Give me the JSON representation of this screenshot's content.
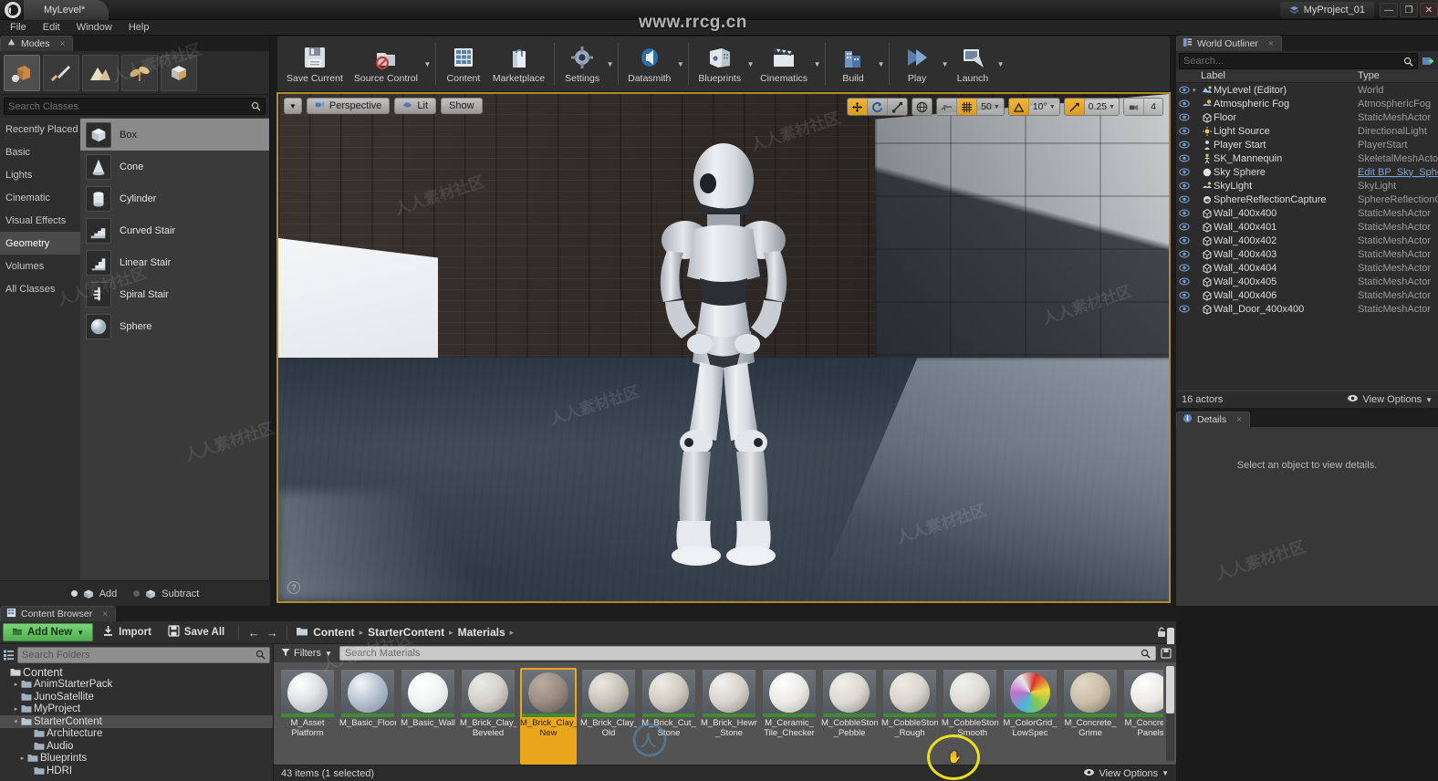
{
  "titlebar": {
    "level_tab": "MyLevel*",
    "project_name": "MyProject_01",
    "minimize": "—",
    "maximize": "❐",
    "close": "✕"
  },
  "menubar": {
    "items": [
      "File",
      "Edit",
      "Window",
      "Help"
    ]
  },
  "watermark": {
    "top_text": "www.rrcg.cn",
    "site": "人人素材社区"
  },
  "modes_panel": {
    "tab_label": "Modes",
    "tab_close": "×",
    "mode_buttons": [
      {
        "name": "place-mode",
        "active": true
      },
      {
        "name": "paint-mode",
        "active": false
      },
      {
        "name": "landscape-mode",
        "active": false
      },
      {
        "name": "foliage-mode",
        "active": false
      },
      {
        "name": "geometry-editing-mode",
        "active": false
      }
    ],
    "search_placeholder": "Search Classes",
    "search_value": "",
    "categories": [
      {
        "label": "Recently Placed",
        "active": false
      },
      {
        "label": "Basic",
        "active": false
      },
      {
        "label": "Lights",
        "active": false
      },
      {
        "label": "Cinematic",
        "active": false
      },
      {
        "label": "Visual Effects",
        "active": false
      },
      {
        "label": "Geometry",
        "active": true
      },
      {
        "label": "Volumes",
        "active": false
      },
      {
        "label": "All Classes",
        "active": false
      }
    ],
    "classes": [
      {
        "label": "Box",
        "selected": true
      },
      {
        "label": "Cone",
        "selected": false
      },
      {
        "label": "Cylinder",
        "selected": false
      },
      {
        "label": "Curved Stair",
        "selected": false
      },
      {
        "label": "Linear Stair",
        "selected": false
      },
      {
        "label": "Spiral Stair",
        "selected": false
      },
      {
        "label": "Sphere",
        "selected": false
      }
    ],
    "brush_mode": {
      "add_label": "Add",
      "subtract_label": "Subtract",
      "selected": "Add"
    }
  },
  "main_toolbar": {
    "items": [
      {
        "label": "Save Current",
        "icon": "save-icon",
        "caret": false
      },
      {
        "label": "Source Control",
        "icon": "source-control-icon",
        "caret": true
      },
      {
        "label": "Content",
        "icon": "content-icon",
        "caret": false
      },
      {
        "label": "Marketplace",
        "icon": "marketplace-icon",
        "caret": false
      },
      {
        "label": "Settings",
        "icon": "settings-gear-icon",
        "caret": true
      },
      {
        "label": "Datasmith",
        "icon": "datasmith-icon",
        "caret": true
      },
      {
        "label": "Blueprints",
        "icon": "blueprints-icon",
        "caret": true
      },
      {
        "label": "Cinematics",
        "icon": "clapperboard-icon",
        "caret": true
      },
      {
        "label": "Build",
        "icon": "build-icon",
        "caret": true
      },
      {
        "label": "Play",
        "icon": "play-icon",
        "caret": true
      },
      {
        "label": "Launch",
        "icon": "launch-icon",
        "caret": true
      }
    ]
  },
  "viewport": {
    "view_type": "Perspective",
    "view_mode": "Lit",
    "show_menu": "Show",
    "transform_tools": [
      "translate-gizmo",
      "rotate-gizmo",
      "scale-gizmo"
    ],
    "coordinate_system": "world-space",
    "surface_snap": "surface-snap-icon",
    "grid_snap_enabled": true,
    "grid_snap_value": "50",
    "angle_snap_value": "10°",
    "scale_snap_value": "0.25",
    "camera_speed_value": "4",
    "help_badge": "?"
  },
  "outliner": {
    "tab_label": "World Outliner",
    "tab_close": "×",
    "search_placeholder": "Search...",
    "search_value": "",
    "columns": {
      "label": "Label",
      "type": "Type"
    },
    "rows": [
      {
        "label": "MyLevel (Editor)",
        "type": "World",
        "depth": 0,
        "expander": "▾",
        "icon": "world-icon",
        "link": false
      },
      {
        "label": "Atmospheric Fog",
        "type": "AtmosphericFog",
        "depth": 1,
        "expander": "",
        "icon": "fog-icon",
        "link": false
      },
      {
        "label": "Floor",
        "type": "StaticMeshActor",
        "depth": 1,
        "expander": "",
        "icon": "mesh-icon",
        "link": false
      },
      {
        "label": "Light Source",
        "type": "DirectionalLight",
        "depth": 1,
        "expander": "",
        "icon": "light-icon",
        "link": false
      },
      {
        "label": "Player Start",
        "type": "PlayerStart",
        "depth": 1,
        "expander": "",
        "icon": "player-icon",
        "link": false
      },
      {
        "label": "SK_Mannequin",
        "type": "SkeletalMeshActor",
        "depth": 1,
        "expander": "",
        "icon": "skeleton-icon",
        "link": false
      },
      {
        "label": "Sky Sphere",
        "type": "Edit BP_Sky_Sphere",
        "depth": 1,
        "expander": "",
        "icon": "sphere-icon",
        "link": true
      },
      {
        "label": "SkyLight",
        "type": "SkyLight",
        "depth": 1,
        "expander": "",
        "icon": "skylight-icon",
        "link": false
      },
      {
        "label": "SphereReflectionCapture",
        "type": "SphereReflectionCapture",
        "depth": 1,
        "expander": "",
        "icon": "reflection-icon",
        "link": false
      },
      {
        "label": "Wall_400x400",
        "type": "StaticMeshActor",
        "depth": 1,
        "expander": "",
        "icon": "mesh-icon",
        "link": false
      },
      {
        "label": "Wall_400x401",
        "type": "StaticMeshActor",
        "depth": 1,
        "expander": "",
        "icon": "mesh-icon",
        "link": false
      },
      {
        "label": "Wall_400x402",
        "type": "StaticMeshActor",
        "depth": 1,
        "expander": "",
        "icon": "mesh-icon",
        "link": false
      },
      {
        "label": "Wall_400x403",
        "type": "StaticMeshActor",
        "depth": 1,
        "expander": "",
        "icon": "mesh-icon",
        "link": false
      },
      {
        "label": "Wall_400x404",
        "type": "StaticMeshActor",
        "depth": 1,
        "expander": "",
        "icon": "mesh-icon",
        "link": false
      },
      {
        "label": "Wall_400x405",
        "type": "StaticMeshActor",
        "depth": 1,
        "expander": "",
        "icon": "mesh-icon",
        "link": false
      },
      {
        "label": "Wall_400x406",
        "type": "StaticMeshActor",
        "depth": 1,
        "expander": "",
        "icon": "mesh-icon",
        "link": false
      },
      {
        "label": "Wall_Door_400x400",
        "type": "StaticMeshActor",
        "depth": 1,
        "expander": "",
        "icon": "mesh-icon",
        "link": false
      }
    ],
    "actor_count": "16 actors",
    "view_options": "View Options"
  },
  "details": {
    "tab_label": "Details",
    "tab_close": "×",
    "empty_message": "Select an object to view details."
  },
  "content_browser": {
    "tab_label": "Content Browser",
    "tab_close": "×",
    "add_new": "Add New",
    "import": "Import",
    "save_all": "Save All",
    "nav_back": "←",
    "nav_forward": "→",
    "breadcrumbs": [
      "Content",
      "StarterContent",
      "Materials"
    ],
    "breadcrumb_sep": "▸",
    "tree_search_placeholder": "Search Folders",
    "tree_search_value": "",
    "tree": [
      {
        "label": "Content",
        "depth": 0,
        "expander": "",
        "selected": false
      },
      {
        "label": "AnimStarterPack",
        "depth": 1,
        "expander": "▸",
        "selected": false
      },
      {
        "label": "JunoSatellite",
        "depth": 1,
        "expander": "",
        "selected": false
      },
      {
        "label": "MyProject",
        "depth": 1,
        "expander": "▸",
        "selected": false
      },
      {
        "label": "StarterContent",
        "depth": 1,
        "expander": "▾",
        "selected": true
      },
      {
        "label": "Architecture",
        "depth": 2,
        "expander": "",
        "selected": false
      },
      {
        "label": "Audio",
        "depth": 2,
        "expander": "",
        "selected": false
      },
      {
        "label": "Blueprints",
        "depth": 2,
        "expander": "▸",
        "selected": false
      },
      {
        "label": "HDRI",
        "depth": 2,
        "expander": "",
        "selected": false
      }
    ],
    "filters_label": "Filters",
    "asset_search_placeholder": "Search Materials",
    "asset_search_value": "",
    "assets": [
      {
        "name": "M_Asset Platform",
        "color": "#e2e4e6",
        "selected": false
      },
      {
        "name": "M_Basic_Floor",
        "color": "#b9c6d4",
        "selected": false
      },
      {
        "name": "M_Basic_Wall",
        "color": "#f2f3f4",
        "selected": false
      },
      {
        "name": "M_Brick_Clay_ Beveled",
        "color": "#d3d0ca",
        "selected": false
      },
      {
        "name": "M_Brick_Clay_ New",
        "color": "#9a8d82",
        "selected": true
      },
      {
        "name": "M_Brick_Clay_ Old",
        "color": "#c7c2b8",
        "selected": false
      },
      {
        "name": "M_Brick_Cut_ Stone",
        "color": "#cfcbc2",
        "selected": false
      },
      {
        "name": "M_Brick_Hewn _Stone",
        "color": "#d6d3cc",
        "selected": false
      },
      {
        "name": "M_Ceramic_ Tile_Checker",
        "color": "#ebe9e6",
        "selected": false
      },
      {
        "name": "M_CobbleStone _Pebble",
        "color": "#dcd9d2",
        "selected": false
      },
      {
        "name": "M_CobbleStone _Rough",
        "color": "#d8d5cf",
        "selected": false
      },
      {
        "name": "M_CobbleStone _Smooth",
        "color": "#dedbd5",
        "selected": false
      },
      {
        "name": "M_ColorGrid_ LowSpec",
        "color": "#f0d43a",
        "selected": false
      },
      {
        "name": "M_Concrete_ Grime",
        "color": "#c9bda8",
        "selected": false
      },
      {
        "name": "M_Concrete_ Panels",
        "color": "#eceae7",
        "selected": false
      }
    ],
    "status": "43 items (1 selected)",
    "view_options": "View Options"
  }
}
